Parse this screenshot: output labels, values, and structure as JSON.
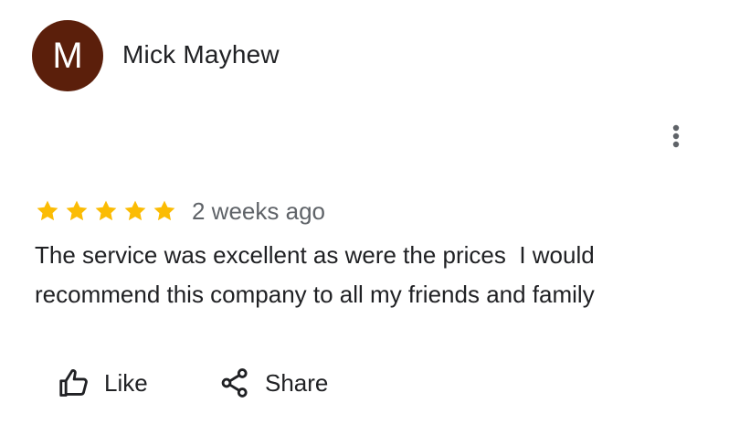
{
  "review": {
    "author": {
      "initial": "M",
      "name": "Mick Mayhew",
      "avatar_color": "#5b1f0b"
    },
    "more_options_icon": "vertical-ellipsis-icon",
    "rating": {
      "stars": 5,
      "max_stars": 5,
      "star_color": "#fbbc04",
      "star_icon": "star-icon"
    },
    "timestamp": "2 weeks ago",
    "text": "The service was excellent as were the prices  I would recommend this company to all my friends and family"
  },
  "actions": {
    "like": {
      "label": "Like",
      "icon": "thumbs-up-icon"
    },
    "share": {
      "label": "Share",
      "icon": "share-icon"
    }
  },
  "colors": {
    "primary_text": "#202124",
    "secondary_text": "#5f6368",
    "icon": "#5f6368"
  }
}
